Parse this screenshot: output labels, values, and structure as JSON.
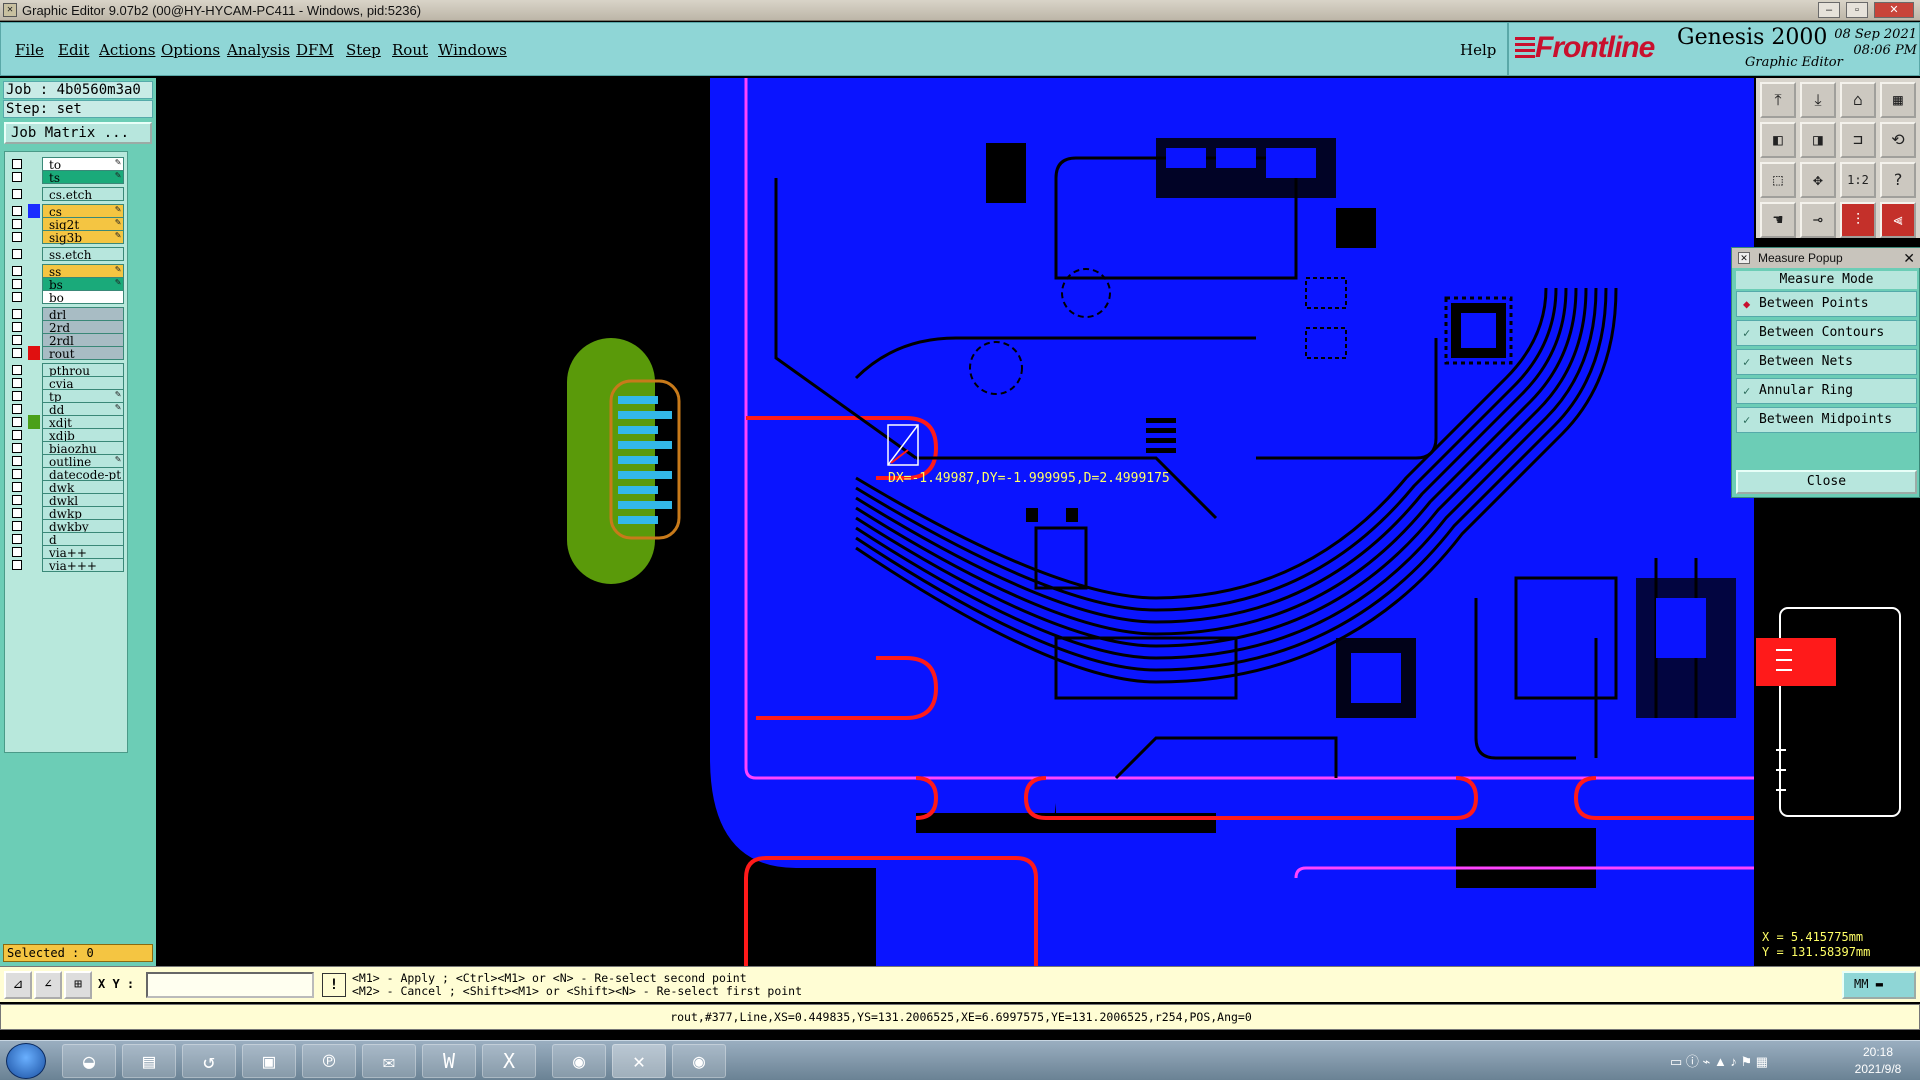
{
  "window": {
    "title": "Graphic Editor 9.07b2 (00@HY-HYCAM-PC411 - Windows, pid:5236)",
    "controls": {
      "minimize": "–",
      "restore": "▫",
      "close": "✕"
    }
  },
  "menu": {
    "items": [
      "File",
      "Edit",
      "Actions",
      "Options",
      "Analysis",
      "DFM",
      "Step",
      "Rout",
      "Windows"
    ],
    "help": "Help"
  },
  "brand": {
    "logo": "Frontline",
    "product": "Genesis 2000",
    "subtitle": "Graphic Editor",
    "date": "08 Sep 2021",
    "time": "08:06 PM"
  },
  "job": {
    "job_label": "Job : 4b0560m3a0",
    "step_label": "Step: set",
    "matrix_button": "Job Matrix ..."
  },
  "layers": [
    {
      "name": "to",
      "color": "#ffffff",
      "swatch": "",
      "editable": true
    },
    {
      "name": "ts",
      "color": "#1aaa7a",
      "swatch": "",
      "editable": true
    },
    {
      "name": "cs.etch",
      "color": "#b7e6dd",
      "swatch": "",
      "editable": false
    },
    {
      "name": "cs",
      "color": "#f4c542",
      "swatch": "#1a2cff",
      "editable": true
    },
    {
      "name": "sig2t",
      "color": "#f4c542",
      "swatch": "",
      "editable": true
    },
    {
      "name": "sig3b",
      "color": "#f4c542",
      "swatch": "",
      "editable": true
    },
    {
      "name": "ss.etch",
      "color": "#b7e6dd",
      "swatch": "",
      "editable": false
    },
    {
      "name": "ss",
      "color": "#f4c542",
      "swatch": "",
      "editable": true
    },
    {
      "name": "bs",
      "color": "#1aaa7a",
      "swatch": "",
      "editable": true
    },
    {
      "name": "bo",
      "color": "#ffffff",
      "swatch": "",
      "editable": false
    },
    {
      "name": "drl",
      "color": "#a8bcc4",
      "swatch": "",
      "editable": false
    },
    {
      "name": "2rd",
      "color": "#a8bcc4",
      "swatch": "",
      "editable": false
    },
    {
      "name": "2rdl",
      "color": "#a8bcc4",
      "swatch": "",
      "editable": false
    },
    {
      "name": "rout",
      "color": "#a8bcc4",
      "swatch": "#e01010",
      "editable": false
    },
    {
      "name": "pthrou",
      "color": "#b7e6dd",
      "swatch": "",
      "editable": false
    },
    {
      "name": "cvia",
      "color": "#b7e6dd",
      "swatch": "",
      "editable": false
    },
    {
      "name": "tp",
      "color": "#b7e6dd",
      "swatch": "",
      "editable": true
    },
    {
      "name": "dd",
      "color": "#b7e6dd",
      "swatch": "",
      "editable": true
    },
    {
      "name": "xdjt",
      "color": "#b7e6dd",
      "swatch": "#4aa01a",
      "editable": false
    },
    {
      "name": "xdjb",
      "color": "#b7e6dd",
      "swatch": "",
      "editable": false
    },
    {
      "name": "biaozhu",
      "color": "#b7e6dd",
      "swatch": "",
      "editable": false
    },
    {
      "name": "outline",
      "color": "#b7e6dd",
      "swatch": "",
      "editable": true
    },
    {
      "name": "datecode-pt",
      "color": "#b7e6dd",
      "swatch": "",
      "editable": false
    },
    {
      "name": "dwk",
      "color": "#b7e6dd",
      "swatch": "",
      "editable": false
    },
    {
      "name": "dwkl",
      "color": "#b7e6dd",
      "swatch": "",
      "editable": false
    },
    {
      "name": "dwkp",
      "color": "#b7e6dd",
      "swatch": "",
      "editable": false
    },
    {
      "name": "dwkby",
      "color": "#b7e6dd",
      "swatch": "",
      "editable": false
    },
    {
      "name": "d",
      "color": "#b7e6dd",
      "swatch": "",
      "editable": false
    },
    {
      "name": "via++",
      "color": "#b7e6dd",
      "swatch": "",
      "editable": false
    },
    {
      "name": "via+++",
      "color": "#b7e6dd",
      "swatch": "",
      "editable": false
    }
  ],
  "selected_label": "Selected : 0",
  "canvas": {
    "measure_readout": "DX=-1.49987,DY=-1.999995,D=2.4999175",
    "colors": {
      "board": "#0a14ff",
      "trace": "#000000",
      "rout": "#ff1a1a",
      "outline": "#ff44ff",
      "pads": "#33b8e8",
      "connector": "#5a9a0a"
    }
  },
  "measure_popup": {
    "title": "Measure Popup",
    "mode_label": "Measure Mode",
    "options": [
      {
        "label": "Between Points",
        "active": true
      },
      {
        "label": "Between Contours",
        "active": false
      },
      {
        "label": "Between Nets",
        "active": false
      },
      {
        "label": "Annular Ring",
        "active": false
      },
      {
        "label": "Between Midpoints",
        "active": false
      }
    ],
    "close_label": "Close"
  },
  "coords": {
    "x": "X = 5.415775mm",
    "y": "Y = 131.58397mm"
  },
  "command": {
    "xy_label": "X Y :",
    "xy_value": "",
    "hint_line1": "<M1> - Apply  ; <Ctrl><M1> or <N> - Re-select second point",
    "hint_line2": "<M2> - Cancel ; <Shift><M1> or <Shift><N> - Re-select first point",
    "units": "MM"
  },
  "status_line": "rout,#377,Line,XS=0.449835,YS=131.2006525,XE=6.6997575,YE=131.2006525,r254,POS,Ang=0",
  "taskbar": {
    "date": "2021/9/8",
    "time": "20:18"
  }
}
